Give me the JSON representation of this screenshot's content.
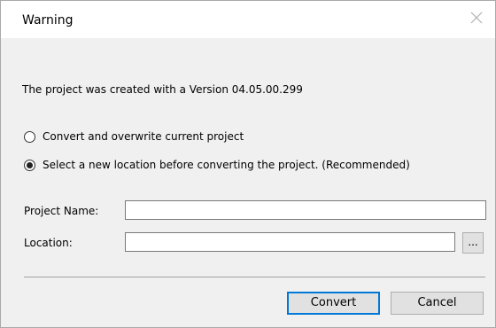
{
  "dialog": {
    "title": "Warning",
    "message": "The project was created with a Version 04.05.00.299"
  },
  "options": [
    {
      "label": "Convert and overwrite current project",
      "selected": false
    },
    {
      "label": "Select a new location before converting the project. (Recommended)",
      "selected": true
    }
  ],
  "form": {
    "project_name_label": "Project Name:",
    "project_name_value": "",
    "location_label": "Location:",
    "location_value": "",
    "browse_label": "..."
  },
  "buttons": {
    "convert_label": "Convert",
    "cancel_label": "Cancel"
  }
}
